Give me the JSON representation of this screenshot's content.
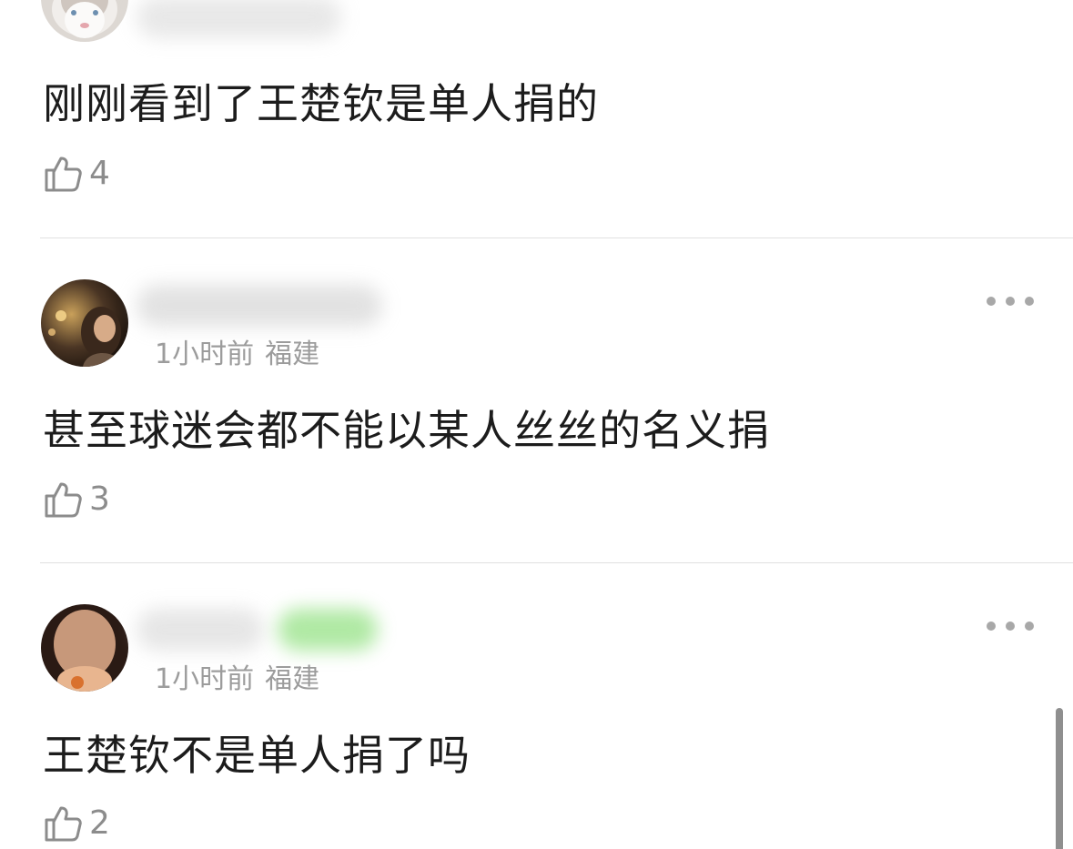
{
  "comments": [
    {
      "username": "",
      "time": "",
      "location": "",
      "text": "刚刚看到了王楚钦是单人捐的",
      "likes": "4"
    },
    {
      "username": "",
      "time": "1小时前",
      "location": "福建",
      "text": "甚至球迷会都不能以某人丝丝的名义捐",
      "likes": "3"
    },
    {
      "username": "",
      "time": "1小时前",
      "location": "福建",
      "text": "王楚钦不是单人捐了吗",
      "likes": "2"
    }
  ],
  "icons": {
    "like": "thumbs-up-icon",
    "more": "more-options-icon"
  },
  "colors": {
    "text": "#1c1c1c",
    "meta": "#9c9c9c",
    "icon": "#8c8c8c",
    "divider": "#e0e0e0",
    "background": "#ffffff"
  }
}
